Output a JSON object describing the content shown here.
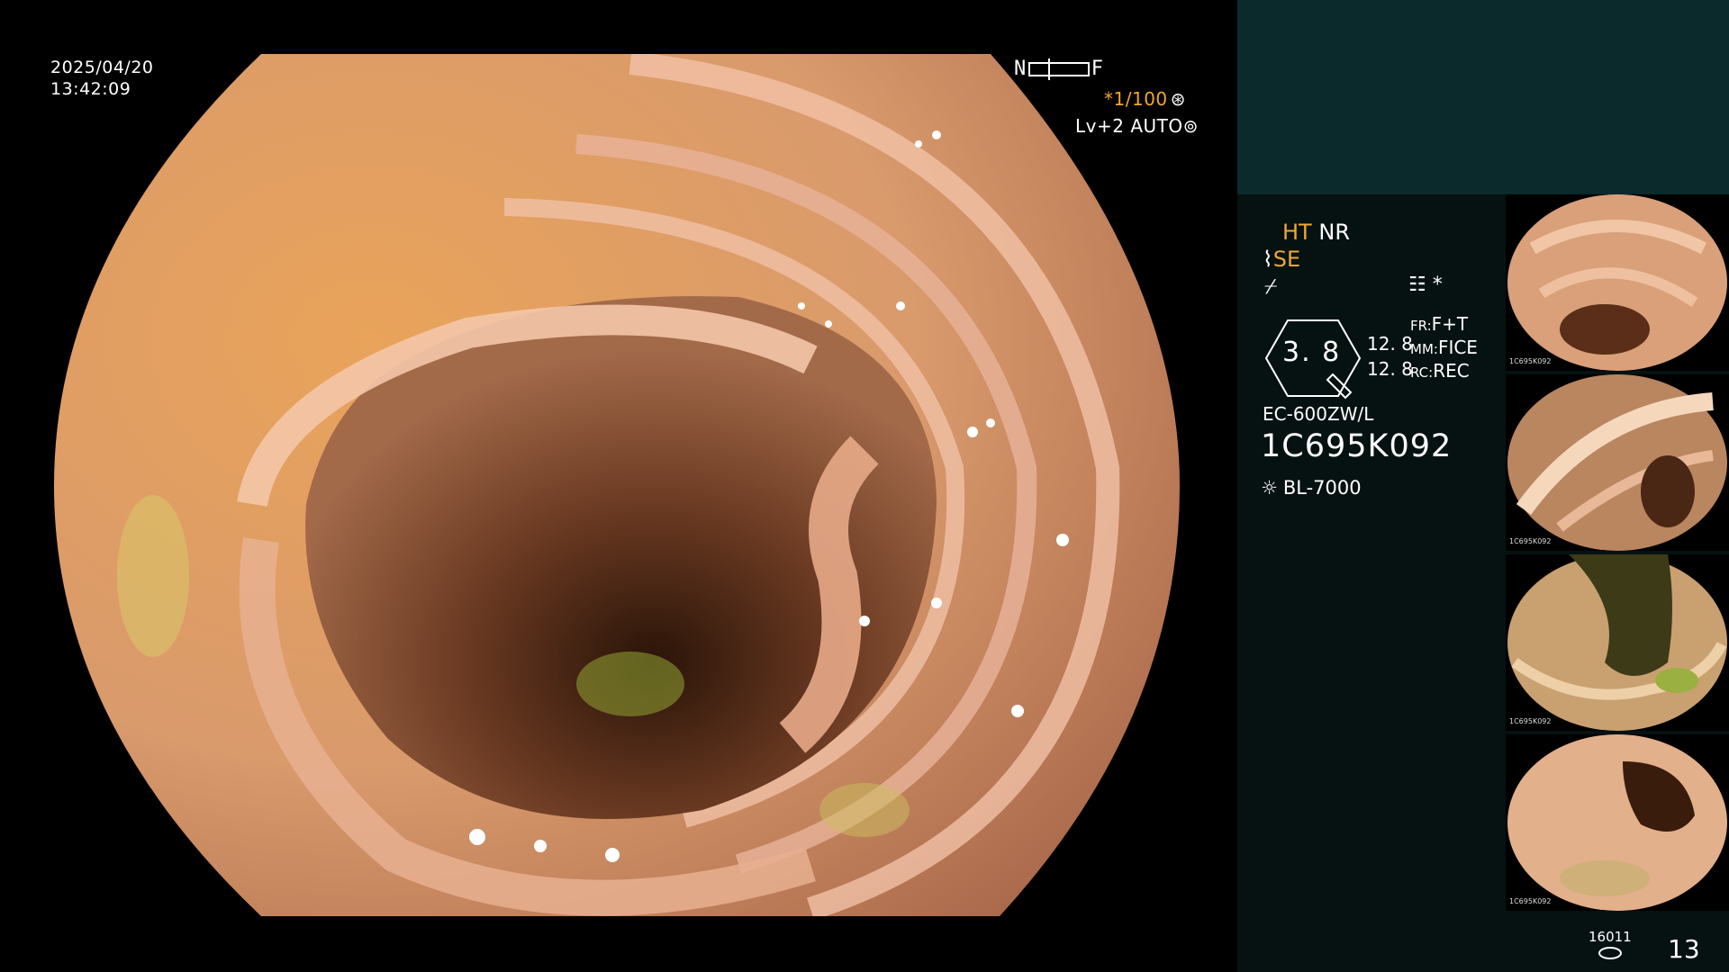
{
  "overlay": {
    "date": "2025/04/20",
    "time": "13:42:09",
    "nf_left": "N",
    "nf_right": "F",
    "magnification": "*1/100",
    "level": "Lv+2 AUTO"
  },
  "settings": {
    "ht": "HT",
    "nr": "NR",
    "se": "SE",
    "cut_symbol": "⌿",
    "star": "*",
    "gauge_value": "3. 8",
    "fice_value_1": "12. 8",
    "fice_value_2": "12. 8",
    "fr_label": "FR:",
    "fr_value": "F+T",
    "mm_label": "MM:",
    "mm_value": "FICE",
    "rc_label": "RC:",
    "rc_value": "REC"
  },
  "scope": {
    "model": "EC-600ZW/L",
    "serial": "1C695K092",
    "light_source": "BL-7000"
  },
  "thumbnails": [
    {
      "code": "1C695K092"
    },
    {
      "code": "1C695K092"
    },
    {
      "code": "1C695K092"
    },
    {
      "code": "1C695K092"
    }
  ],
  "footer": {
    "storage_code": "16011",
    "image_count": "13"
  },
  "colors": {
    "mucosa": "#e3a87e",
    "highlight_orange": "#f0a830",
    "panel_bg": "#061212",
    "panel_top_bg": "#0a2a2c"
  }
}
